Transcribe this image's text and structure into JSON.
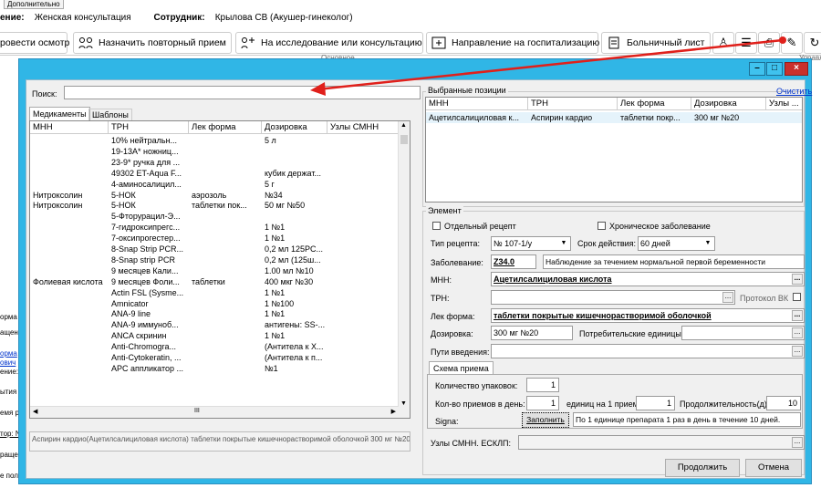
{
  "app": {
    "top_tab": "Дополнительно",
    "department_label": "ение:",
    "department_value": "Женская консультация",
    "employee_label": "Сотрудник:",
    "employee_value": "Крылова СВ (Акушер-гинеколог)",
    "toolbar": {
      "b1": "ровести осмотр",
      "b2": "Назначить повторный прием",
      "b3": "На исследование или консультацию",
      "b4": "Направление на госпитализацию",
      "b5": "Больничный лист",
      "group_main": "Основное",
      "group_manage": "Управле"
    },
    "left_snippets": [
      "орма",
      "ащен",
      "орма",
      "ович",
      "ение:",
      "ытия",
      "емя р",
      "тор: N",
      "ращен",
      "е пол"
    ]
  },
  "dialog": {
    "search_label": "Поиск:",
    "search_value": "",
    "tabs": [
      "Медикаменты",
      "Шаблоны"
    ],
    "columns": [
      "МНН",
      "ТРН",
      "Лек форма",
      "Дозировка",
      "Узлы СМНН"
    ],
    "rows": [
      [
        "",
        "10% нейтральн...",
        "",
        "5 л"
      ],
      [
        "",
        "19-13А* ножниц...",
        "",
        ""
      ],
      [
        "",
        "23-9* ручка для ...",
        "",
        ""
      ],
      [
        "",
        "49302 ET-Aqua F...",
        "",
        "кубик держат..."
      ],
      [
        "",
        "4-аминосалицил...",
        "",
        "5 г"
      ],
      [
        "Нитроксолин",
        "5-НОК",
        "аэрозоль",
        "№34"
      ],
      [
        "Нитроксолин",
        "5-НОК",
        "таблетки пок...",
        "50 мг №50"
      ],
      [
        "",
        "5-Фторурацил-Э...",
        "",
        ""
      ],
      [
        "",
        "7-гидроксипрегс...",
        "",
        "1 №1"
      ],
      [
        "",
        "7-оксипрогестер...",
        "",
        "1 №1"
      ],
      [
        "",
        "8-Snap Strip PCR...",
        "",
        "0,2 мл 125PC..."
      ],
      [
        "",
        "8-Snap strip PCR",
        "",
        "0,2 мл (125ш..."
      ],
      [
        "",
        "9 месяцев Кали...",
        "",
        "1.00 мл №10"
      ],
      [
        "Фолиевая кислота",
        "9 месяцев Фоли...",
        "таблетки",
        "400 мкг №30"
      ],
      [
        "",
        "Actin FSL  (Sysme...",
        "",
        "1 №1"
      ],
      [
        "",
        "Amnicator",
        "",
        "1 №100"
      ],
      [
        "",
        "ANA-9 line",
        "",
        "1 №1"
      ],
      [
        "",
        "ANA-9 иммуноб...",
        "",
        "антигены: SS-..."
      ],
      [
        "",
        "ANCA скринин",
        "",
        "1 №1"
      ],
      [
        "",
        "Anti-Chromogra...",
        "",
        "(Антитела к Х..."
      ],
      [
        "",
        "Anti-Cytokeratin, ...",
        "",
        "(Антитела к п..."
      ],
      [
        "",
        "APC аппликатор ...",
        "",
        "№1"
      ]
    ],
    "footer_text": "Аспирин кардио(Ацетилсалициловая кислота) таблетки покрытые кишечнорастворимой оболочкой 300 мг №20",
    "selected": {
      "title": "Выбранные позиции",
      "clear_link": "Очистить",
      "columns": [
        "МНН",
        "ТРН",
        "Лек форма",
        "Дозировка",
        "Узлы ..."
      ],
      "rows": [
        [
          "Ацетилсалициловая к...",
          "Аспирин кардио",
          "таблетки покр...",
          "300 мг №20",
          ""
        ]
      ]
    },
    "element": {
      "title": "Элемент",
      "separate_recipe": "Отдельный рецепт",
      "chronic": "Хроническое заболевание",
      "recipe_type_label": "Тип рецепта:",
      "recipe_type_value": "№ 107-1/у",
      "validity_label": "Срок действия:",
      "validity_value": "60 дней",
      "disease_label": "Заболевание:",
      "disease_code": "Z34.0",
      "disease_name": "Наблюдение за течением нормальной первой беременности",
      "mnn_label": "МНН:",
      "mnn_value": "Ацетилсалициловая кислота",
      "trn_label": "ТРН:",
      "trn_value": "",
      "protocol_vk": "Протокол ВК",
      "form_label": "Лек форма:",
      "form_value": "таблетки покрытые кишечнорастворимой оболочкой",
      "dosage_label": "Дозировка:",
      "dosage_value": "300 мг №20",
      "consumer_units_label": "Потребительские единицы:",
      "consumer_units_value": "",
      "routes_label": "Пути введения:",
      "routes_value": "",
      "scheme_tab": "Схема приема",
      "packages_label": "Количество упаковок:",
      "packages_value": "1",
      "times_label": "Кол-во приемов в день:",
      "times_value": "1",
      "units_label": "единиц на 1 прием:",
      "units_value": "1",
      "duration_label": "Продолжительность(д):",
      "duration_value": "10",
      "signa_label": "Signa:",
      "fill_button": "Заполнить",
      "signa_value": "По 1 единице препарата 1 раз в день в течение 10 дней.",
      "nodes_label": "Узлы СМНН. ЕСКЛП:",
      "nodes_value": ""
    },
    "continue_button": "Продолжить",
    "cancel_button": "Отмена"
  },
  "colors": {
    "titlebar": "#30b6e6",
    "arrow": "#e0201b",
    "link": "#0033cc"
  }
}
